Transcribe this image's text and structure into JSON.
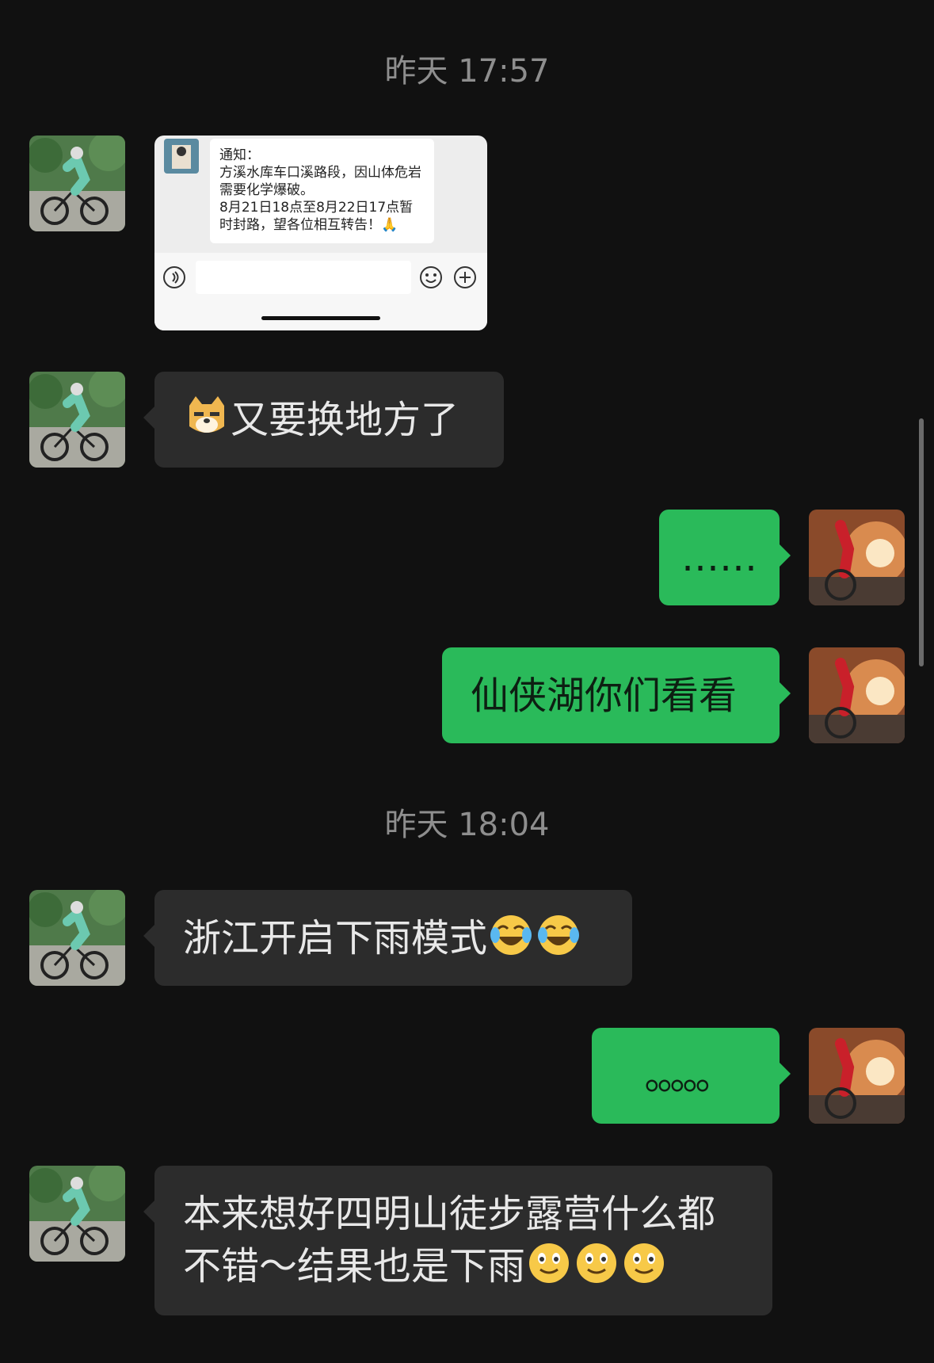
{
  "timestamps": [
    "昨天 17:57",
    "昨天 18:04"
  ],
  "shared_screenshot": {
    "notice_text": "通知：\n方溪水库车口溪路段，因山体危岩需要化学爆破。\n8月21日18点至8月22日17点暂时封路，望各位相互转告！🙏",
    "icons": [
      "voice-icon",
      "emoji-icon",
      "plus-icon"
    ]
  },
  "messages": [
    {
      "side": "in",
      "text": "又要换地方了",
      "emoji_before": "doge-emoji"
    },
    {
      "side": "out",
      "text": "……"
    },
    {
      "side": "out",
      "text": "仙侠湖你们看看"
    },
    {
      "side": "in",
      "text": "浙江开启下雨模式",
      "emoji_after": "tears-of-joy-emoji ×2"
    },
    {
      "side": "out",
      "text": "。。。。。"
    },
    {
      "side": "in",
      "text_line1": "本来想好四明山徒步露营什么都",
      "text_line2": "不错～结果也是下雨",
      "emoji_after": "slightly-smiling-emoji ×3"
    }
  ],
  "colors": {
    "background": "#111111",
    "incoming": "#2c2c2c",
    "outgoing": "#2aba5a",
    "timestamp": "#8e8e8e"
  }
}
